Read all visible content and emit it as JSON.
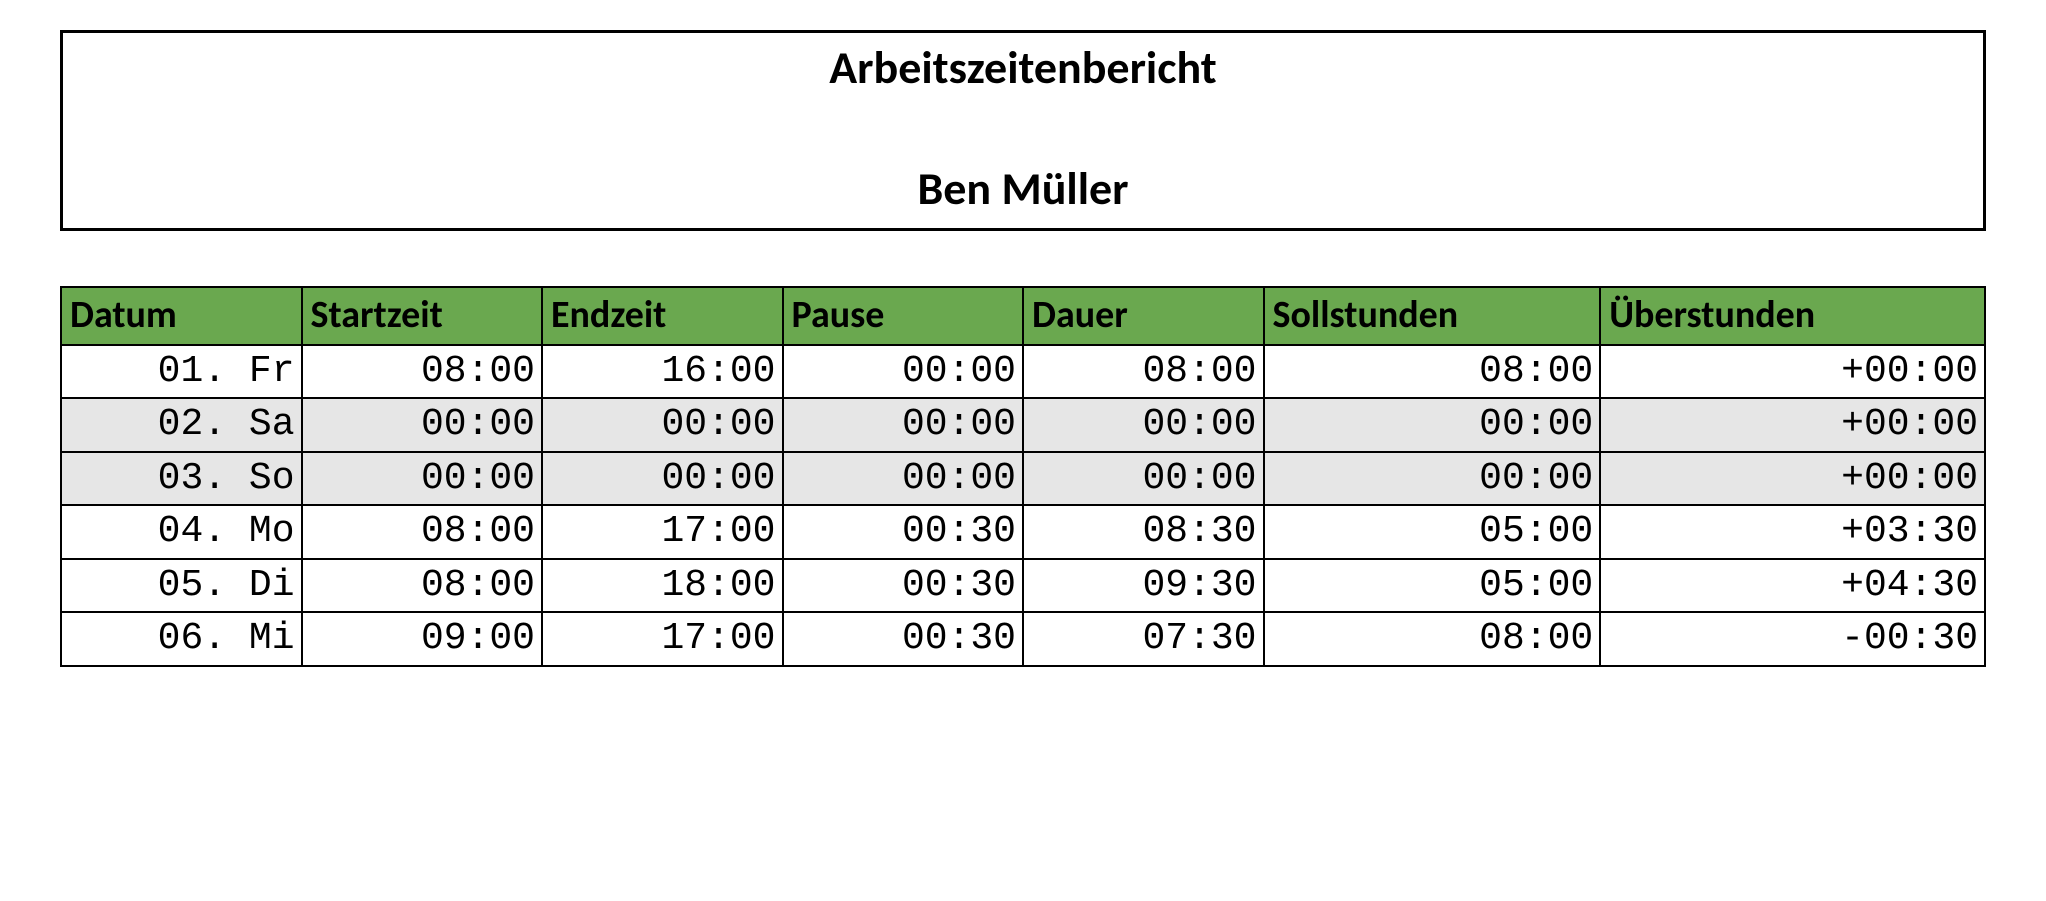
{
  "header": {
    "title": "Arbeitszeitenbericht",
    "name": "Ben Müller"
  },
  "table": {
    "columns": {
      "datum": "Datum",
      "start": "Startzeit",
      "end": "Endzeit",
      "pause": "Pause",
      "dauer": "Dauer",
      "soll": "Sollstunden",
      "ueber": "Überstunden"
    },
    "rows": [
      {
        "datum": "01. Fr",
        "start": "08:00",
        "end": "16:00",
        "pause": "00:00",
        "dauer": "08:00",
        "soll": "08:00",
        "ueber": "+00:00",
        "shaded": false
      },
      {
        "datum": "02. Sa",
        "start": "00:00",
        "end": "00:00",
        "pause": "00:00",
        "dauer": "00:00",
        "soll": "00:00",
        "ueber": "+00:00",
        "shaded": true
      },
      {
        "datum": "03. So",
        "start": "00:00",
        "end": "00:00",
        "pause": "00:00",
        "dauer": "00:00",
        "soll": "00:00",
        "ueber": "+00:00",
        "shaded": true
      },
      {
        "datum": "04. Mo",
        "start": "08:00",
        "end": "17:00",
        "pause": "00:30",
        "dauer": "08:30",
        "soll": "05:00",
        "ueber": "+03:30",
        "shaded": false
      },
      {
        "datum": "05. Di",
        "start": "08:00",
        "end": "18:00",
        "pause": "00:30",
        "dauer": "09:30",
        "soll": "05:00",
        "ueber": "+04:30",
        "shaded": false
      },
      {
        "datum": "06. Mi",
        "start": "09:00",
        "end": "17:00",
        "pause": "00:30",
        "dauer": "07:30",
        "soll": "08:00",
        "ueber": "-00:30",
        "shaded": false
      }
    ]
  },
  "colors": {
    "headerGreen": "#6aa84f",
    "shade": "#e6e6e6"
  }
}
